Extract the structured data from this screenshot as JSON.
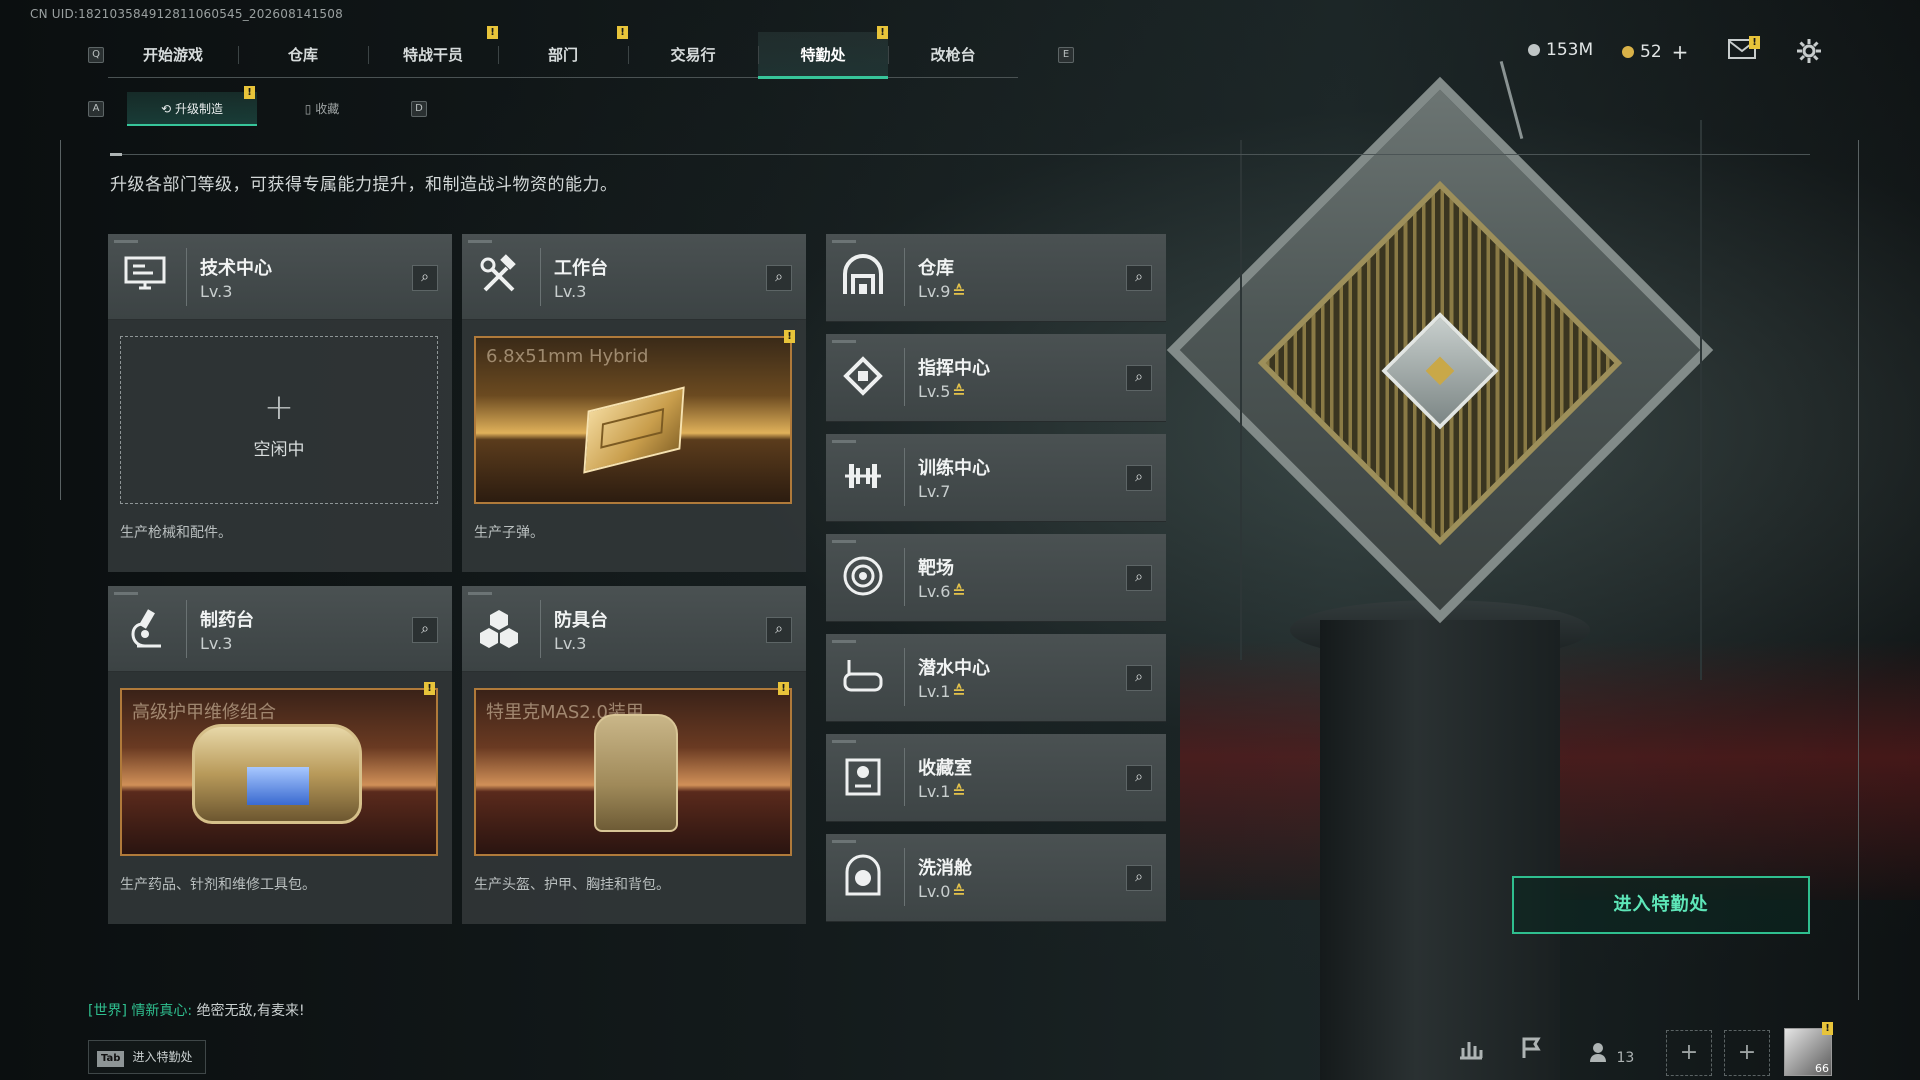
{
  "uid": "CN UID:182103584912811060545_202608141508",
  "key_hints": {
    "prev_tab": "Q",
    "next_tab": "E",
    "prev_sub": "A",
    "next_sub": "D"
  },
  "nav": {
    "tabs": [
      {
        "label": "开始游戏"
      },
      {
        "label": "仓库"
      },
      {
        "label": "特战干员",
        "badge": "!"
      },
      {
        "label": "部门",
        "badge": "!"
      },
      {
        "label": "交易行"
      },
      {
        "label": "特勤处",
        "badge": "!",
        "active": true
      },
      {
        "label": "改枪台"
      }
    ]
  },
  "currency": {
    "coins": "153M",
    "gems": "52",
    "add": "+"
  },
  "icons": {
    "mail": "mail-icon",
    "settings": "gear-icon"
  },
  "subnav": {
    "upgrade": "升级制造",
    "upgrade_badge": "!",
    "collection": "收藏"
  },
  "description": "升级各部门等级，可获得专属能力提升，和制造战斗物资的能力。",
  "production": [
    {
      "name": "技术中心",
      "level": "Lv.3",
      "icon": "computer-icon",
      "status": "空闲中",
      "plus": "+",
      "desc": "生产枪械和配件。"
    },
    {
      "name": "工作台",
      "level": "Lv.3",
      "icon": "hammer-wrench-icon",
      "product": "6.8x51mm Hybrid",
      "badge": "!",
      "desc": "生产子弹。"
    },
    {
      "name": "制药台",
      "level": "Lv.3",
      "icon": "microscope-icon",
      "product": "高级护甲维修组合",
      "badge": "!",
      "desc": "生产药品、针剂和维修工具包。"
    },
    {
      "name": "防具台",
      "level": "Lv.3",
      "icon": "blocks-icon",
      "product": "特里克MAS2.0装甲",
      "badge": "!",
      "desc": "生产头盔、护甲、胸挂和背包。"
    }
  ],
  "departments": [
    {
      "name": "仓库",
      "level": "Lv.9",
      "upgradable": true,
      "icon": "vault-icon"
    },
    {
      "name": "指挥中心",
      "level": "Lv.5",
      "upgradable": true,
      "icon": "command-chip-icon"
    },
    {
      "name": "训练中心",
      "level": "Lv.7",
      "upgradable": false,
      "icon": "dumbbell-icon"
    },
    {
      "name": "靶场",
      "level": "Lv.6",
      "upgradable": true,
      "icon": "target-icon"
    },
    {
      "name": "潜水中心",
      "level": "Lv.1",
      "upgradable": true,
      "icon": "diving-mask-icon"
    },
    {
      "name": "收藏室",
      "level": "Lv.1",
      "upgradable": true,
      "icon": "trophy-case-icon"
    },
    {
      "name": "洗消舱",
      "level": "Lv.0",
      "upgradable": true,
      "icon": "hazmat-icon"
    }
  ],
  "upgrade_symbol": "≙",
  "cta": {
    "label": "进入特勤处"
  },
  "chat": {
    "channel": "[世界]",
    "sender": "情新真心:",
    "message": "绝密无敌,有麦来!"
  },
  "tab_hint": {
    "key": "Tab",
    "label": "进入特勤处"
  },
  "bottom_bar": {
    "friends_count": "13",
    "player_level": "66"
  },
  "colors": {
    "accent": "#37c59a",
    "badge": "#e8c43a",
    "upgrade": "#e3c24a"
  }
}
